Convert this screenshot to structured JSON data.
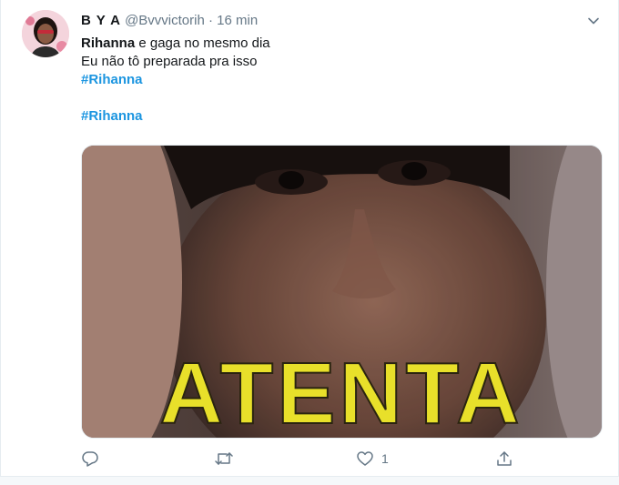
{
  "tweet": {
    "author": {
      "display_name": "B Y A",
      "handle": "@Bvvvictorih",
      "separator": "·",
      "time": "16 min"
    },
    "text": {
      "line1_bold": "Rihanna",
      "line1_rest": " e gaga no mesmo dia",
      "line2": "Eu não tô preparada pra isso",
      "hashtag1": "#Rihanna",
      "hashtag2": "#Rihanna"
    },
    "media": {
      "caption": "ATENTA",
      "caption_color": "#e8e02a"
    },
    "actions": {
      "reply_count": "",
      "retweet_count": "",
      "like_count": "1"
    }
  },
  "colors": {
    "link": "#1b95e0",
    "muted": "#657786",
    "border": "#e6ecf0"
  },
  "icons": [
    "chevron-down-icon",
    "reply-icon",
    "retweet-icon",
    "like-icon",
    "share-icon"
  ]
}
